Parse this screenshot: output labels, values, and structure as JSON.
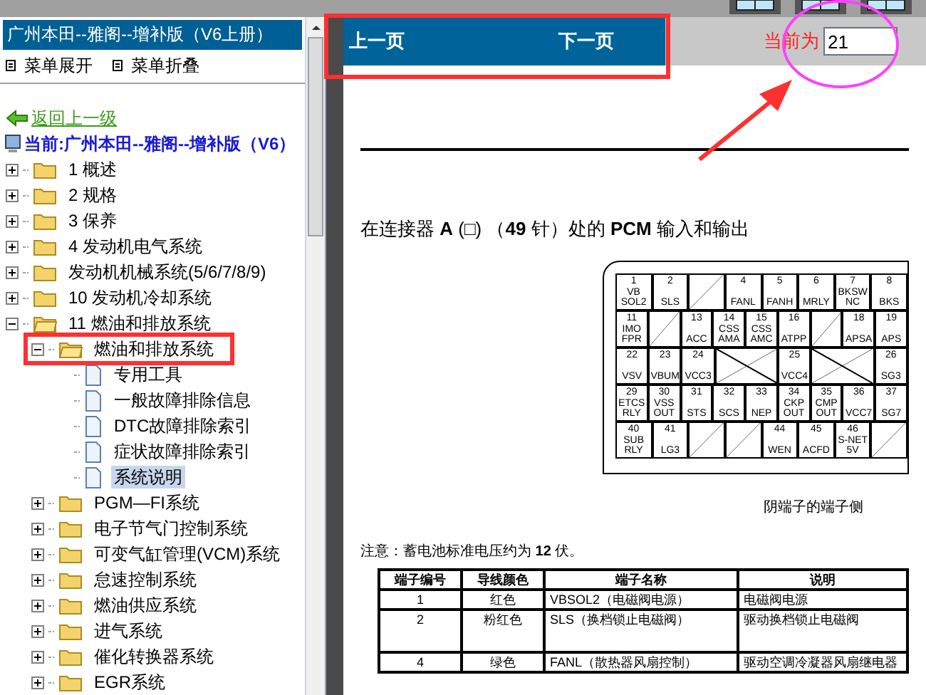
{
  "left_panel": {
    "title": "广州本田--雅阁--增补版（V6上册）",
    "menu_actions": [
      "菜单展开",
      "菜单折叠"
    ],
    "back_link": "返回上一级",
    "current": "当前:广州本田--雅阁--增补版（V6）",
    "tree": [
      {
        "label": "1 概述",
        "kind": "folder",
        "expanded": false,
        "selected": false
      },
      {
        "label": "2 规格",
        "kind": "folder",
        "expanded": false,
        "selected": false
      },
      {
        "label": "3 保养",
        "kind": "folder",
        "expanded": false,
        "selected": false
      },
      {
        "label": "4 发动机电气系统",
        "kind": "folder",
        "expanded": false,
        "selected": false
      },
      {
        "label": "发动机机械系统(5/6/7/8/9)",
        "kind": "folder",
        "expanded": false,
        "selected": false
      },
      {
        "label": "10 发动机冷却系统",
        "kind": "folder",
        "expanded": false,
        "selected": false
      },
      {
        "label": "11 燃油和排放系统",
        "kind": "folder",
        "expanded": true,
        "selected": false,
        "children": [
          {
            "label": "燃油和排放系统",
            "kind": "folder",
            "expanded": true,
            "selected": false,
            "children": [
              {
                "label": "专用工具",
                "kind": "document",
                "selected": false
              },
              {
                "label": "一般故障排除信息",
                "kind": "document",
                "selected": false
              },
              {
                "label": "DTC故障排除索引",
                "kind": "document",
                "selected": false
              },
              {
                "label": "症状故障排除索引",
                "kind": "document",
                "selected": false
              },
              {
                "label": "系统说明",
                "kind": "document",
                "selected": true
              }
            ]
          },
          {
            "label": "PGM—FI系统",
            "kind": "folder",
            "expanded": false,
            "selected": false
          },
          {
            "label": "电子节气门控制系统",
            "kind": "folder",
            "expanded": false,
            "selected": false
          },
          {
            "label": "可变气缸管理(VCM)系统",
            "kind": "folder",
            "expanded": false,
            "selected": false
          },
          {
            "label": "怠速控制系统",
            "kind": "folder",
            "expanded": false,
            "selected": false
          },
          {
            "label": "燃油供应系统",
            "kind": "folder",
            "expanded": false,
            "selected": false
          },
          {
            "label": "进气系统",
            "kind": "folder",
            "expanded": false,
            "selected": false
          },
          {
            "label": "催化转换器系统",
            "kind": "folder",
            "expanded": false,
            "selected": false
          },
          {
            "label": "EGR系统",
            "kind": "folder",
            "expanded": false,
            "selected": false
          }
        ]
      }
    ]
  },
  "nav": {
    "prev": "上一页",
    "next": "下一页",
    "page_label": "当前为",
    "page_value": "21"
  },
  "document": {
    "heading": "在连接器 **A** (□) （**49** 针）处的 **PCM** 输入和输出",
    "connector_rows": [
      [
        {
          "kind": "pin",
          "number": "1",
          "name": "VB SOL2"
        },
        {
          "kind": "pin",
          "number": "2",
          "name": "SLS"
        },
        {
          "kind": "blank"
        },
        {
          "kind": "pin",
          "number": "4",
          "name": "FANL"
        },
        {
          "kind": "pin",
          "number": "5",
          "name": "FANH"
        },
        {
          "kind": "pin",
          "number": "6",
          "name": "MRLY"
        },
        {
          "kind": "pin",
          "number": "7",
          "name": "BKSW NC"
        },
        {
          "kind": "pin",
          "number": "8",
          "name": "BKS"
        }
      ],
      [
        {
          "kind": "pin",
          "number": "11",
          "name": "IMO FPR"
        },
        {
          "kind": "blank"
        },
        {
          "kind": "pin",
          "number": "13",
          "name": "ACC"
        },
        {
          "kind": "pin",
          "number": "14",
          "name": "CSS AMA"
        },
        {
          "kind": "pin",
          "number": "15",
          "name": "CSS AMC"
        },
        {
          "kind": "pin",
          "number": "16",
          "name": "ATPP"
        },
        {
          "kind": "blank"
        },
        {
          "kind": "pin",
          "number": "18",
          "name": "APSA"
        },
        {
          "kind": "pin",
          "number": "19",
          "name": "APS"
        }
      ],
      [
        {
          "kind": "pin",
          "number": "22",
          "name": "VSV"
        },
        {
          "kind": "pin",
          "number": "23",
          "name": "VBUM"
        },
        {
          "kind": "pin",
          "number": "24",
          "name": "VCC3"
        },
        {
          "kind": "cross"
        },
        {
          "kind": "pin",
          "number": "25",
          "name": "VCC4"
        },
        {
          "kind": "cross"
        },
        {
          "kind": "pin",
          "number": "26",
          "name": "SG3"
        }
      ],
      [
        {
          "kind": "pin",
          "number": "29",
          "name": "ETCS RLY"
        },
        {
          "kind": "pin",
          "number": "30",
          "name": "VSS OUT"
        },
        {
          "kind": "pin",
          "number": "31",
          "name": "STS"
        },
        {
          "kind": "pin",
          "number": "32",
          "name": "SCS"
        },
        {
          "kind": "pin",
          "number": "33",
          "name": "NEP"
        },
        {
          "kind": "pin",
          "number": "34",
          "name": "CKP OUT"
        },
        {
          "kind": "pin",
          "number": "35",
          "name": "CMP OUT"
        },
        {
          "kind": "pin",
          "number": "36",
          "name": "VCC7"
        },
        {
          "kind": "pin",
          "number": "37",
          "name": "SG7"
        }
      ],
      [
        {
          "kind": "pin",
          "number": "40",
          "name": "SUB RLY"
        },
        {
          "kind": "pin",
          "number": "41",
          "name": "LG3"
        },
        {
          "kind": "blank"
        },
        {
          "kind": "blank"
        },
        {
          "kind": "pin",
          "number": "44",
          "name": "WEN"
        },
        {
          "kind": "pin",
          "number": "45",
          "name": "ACFD"
        },
        {
          "kind": "pin",
          "number": "46",
          "name": "S-NET 5V"
        },
        {
          "kind": "blank"
        }
      ]
    ],
    "caption": "阴端子的端子侧",
    "note": "注意：蓄电池标准电压约为 **12** 伏。",
    "table": {
      "columns": [
        "端子编号",
        "导线颜色",
        "端子名称",
        "说明"
      ],
      "rows": [
        [
          "1",
          "红色",
          "VBSOL2（电磁阀电源）",
          "电磁阀电源"
        ],
        [
          "2",
          "粉红色",
          "SLS（换档锁止电磁阀）",
          "驱动换档锁止电磁阀"
        ],
        [
          "4",
          "绿色",
          "FANL（散热器风扇控制）",
          "驱动空调冷凝器风扇继电器"
        ]
      ]
    }
  }
}
